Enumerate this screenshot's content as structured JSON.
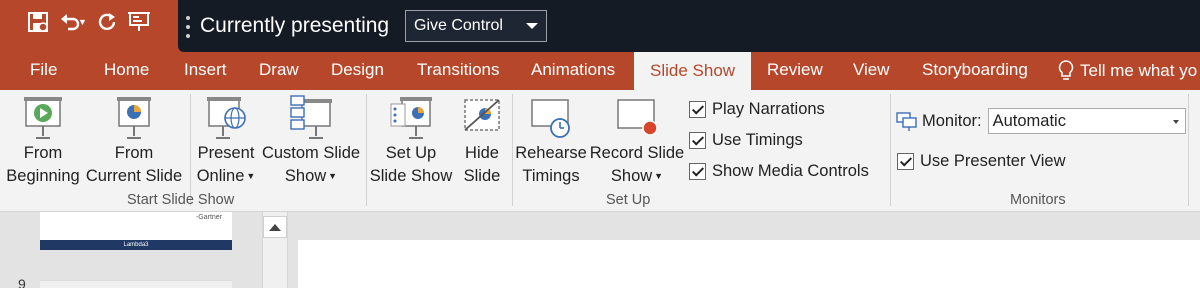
{
  "qat": {
    "items": [
      {
        "icon": "save-icon"
      },
      {
        "icon": "undo-icon"
      },
      {
        "icon": "redo-icon"
      },
      {
        "icon": "start-slideshow-icon"
      }
    ]
  },
  "presenting": {
    "text": "Currently presenting",
    "control_label": "Give Control"
  },
  "tabs": [
    {
      "label": "File"
    },
    {
      "label": "Home"
    },
    {
      "label": "Insert"
    },
    {
      "label": "Draw"
    },
    {
      "label": "Design"
    },
    {
      "label": "Transitions"
    },
    {
      "label": "Animations"
    },
    {
      "label": "Slide Show",
      "active": true
    },
    {
      "label": "Review"
    },
    {
      "label": "View"
    },
    {
      "label": "Storyboarding"
    }
  ],
  "tell_me": "Tell me what yo",
  "ribbon": {
    "start_group": {
      "label": "Start Slide Show",
      "from_beginning": [
        "From",
        "Beginning"
      ],
      "from_current": [
        "From",
        "Current Slide"
      ],
      "present_online": [
        "Present",
        "Online"
      ],
      "custom_show": [
        "Custom Slide",
        "Show"
      ]
    },
    "setup_group": {
      "label": "Set Up",
      "setup_show": [
        "Set Up",
        "Slide Show"
      ],
      "hide_slide": [
        "Hide",
        "Slide"
      ],
      "rehearse": [
        "Rehearse",
        "Timings"
      ],
      "record": [
        "Record Slide",
        "Show"
      ],
      "play_narrations": "Play Narrations",
      "use_timings": "Use Timings",
      "show_media_controls": "Show Media Controls"
    },
    "monitors_group": {
      "label": "Monitors",
      "monitor_label": "Monitor:",
      "monitor_value": "Automatic",
      "use_presenter_view": "Use Presenter View"
    }
  },
  "thumbnails": {
    "thumb1_note": "-Gartner",
    "thumb1_band": "Lambda3",
    "next_slide_number": "9"
  },
  "colors": {
    "accent": "#b7472a",
    "presenting_bar": "#141b25",
    "ribbon_bg": "#f3f3f3"
  }
}
